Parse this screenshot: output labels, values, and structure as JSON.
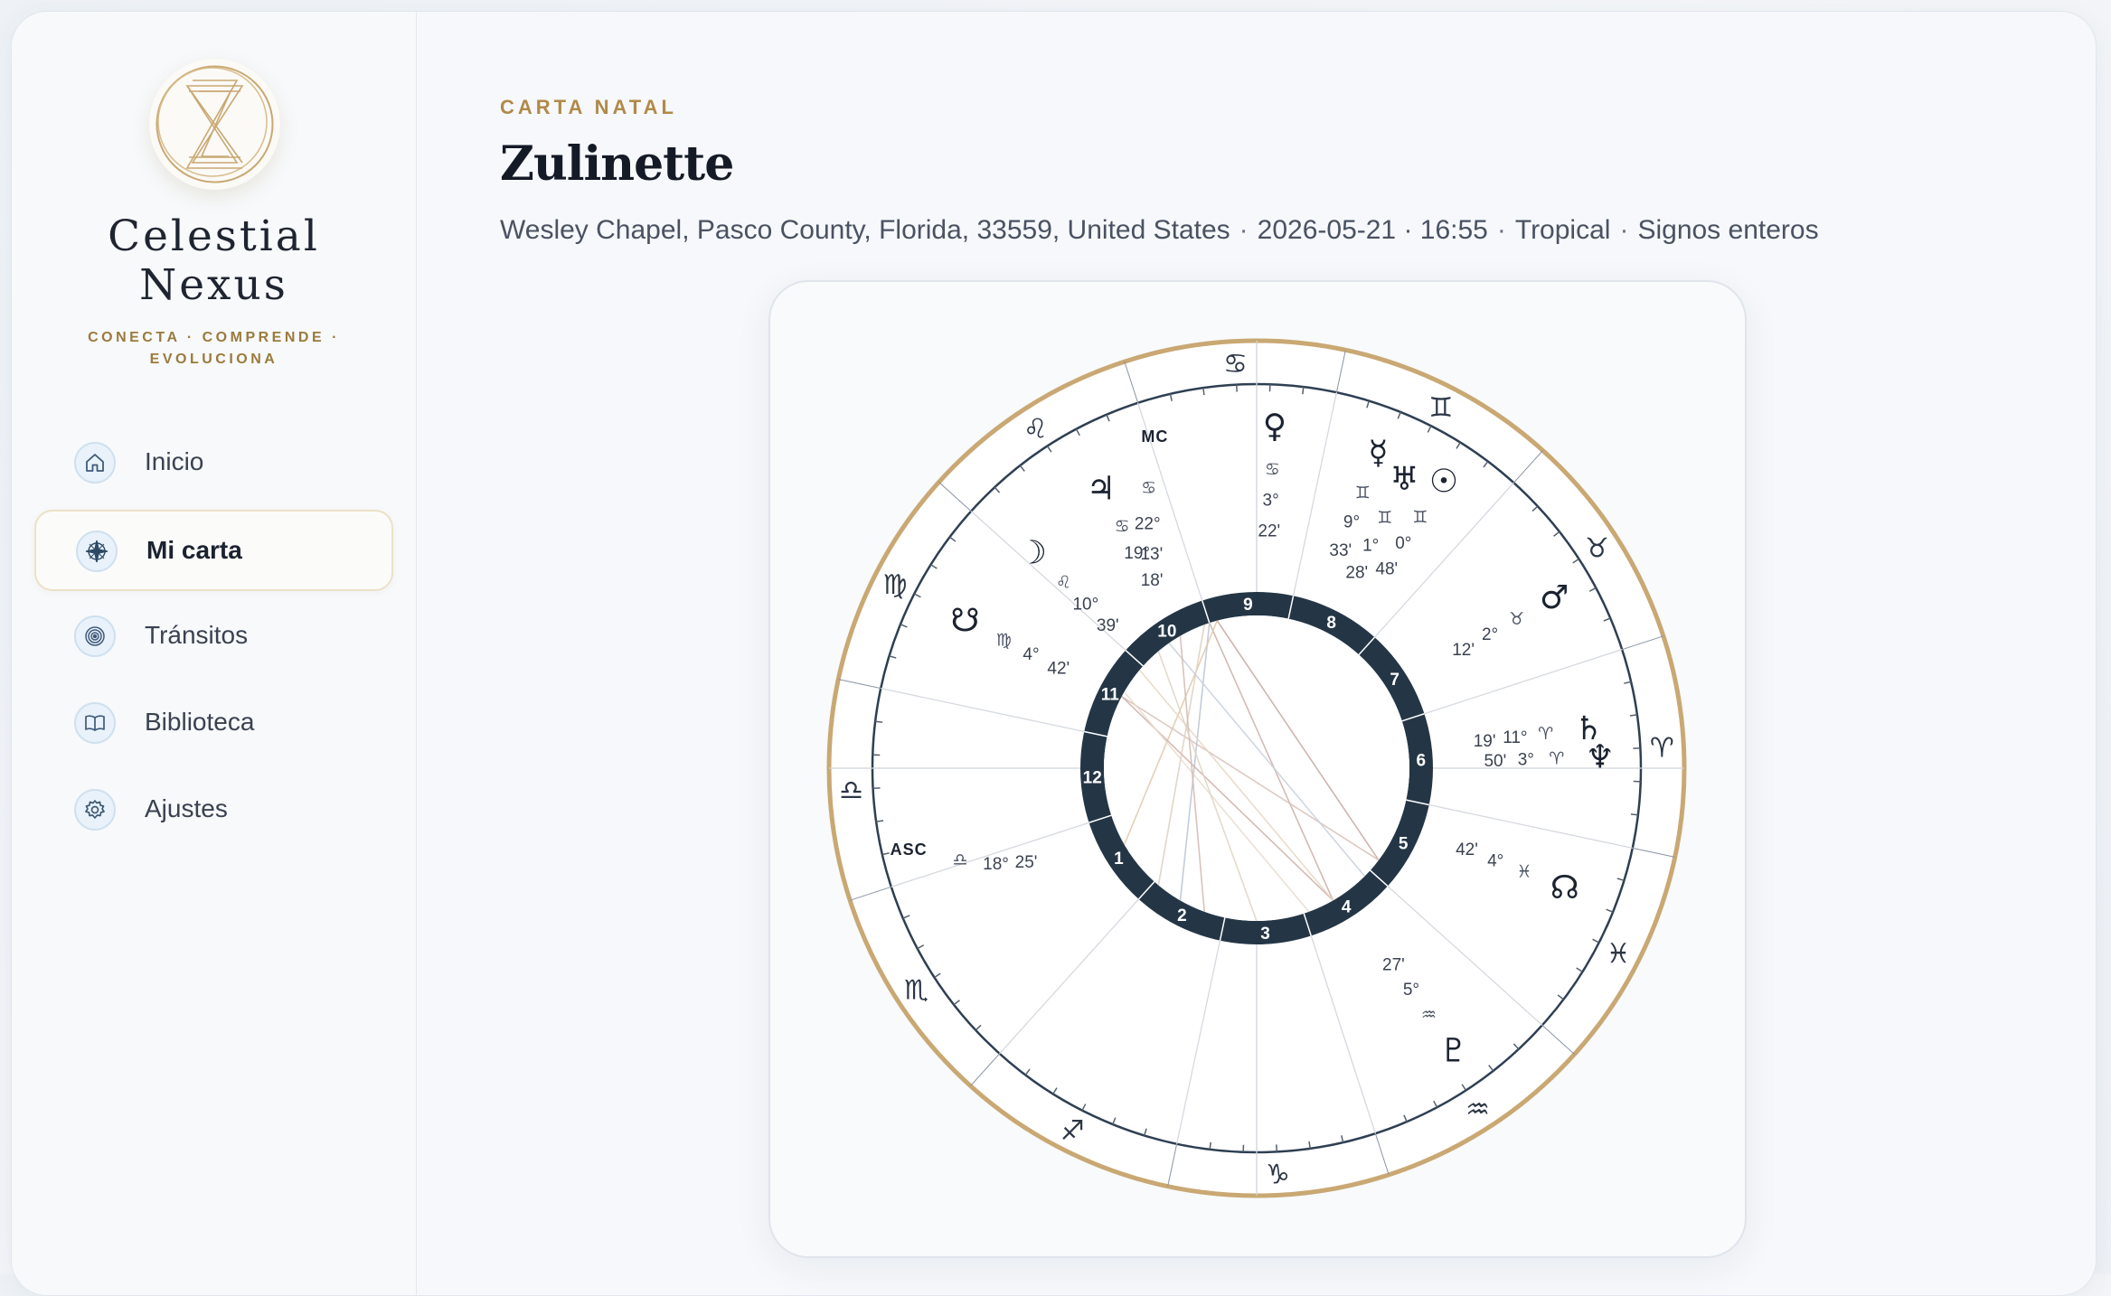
{
  "brand": {
    "name_line1": "Celestial",
    "name_line2": "Nexus",
    "tagline": "CONECTA · COMPRENDE · EVOLUCIONA"
  },
  "nav": [
    {
      "label": "Inicio",
      "icon": "home-icon",
      "active": false
    },
    {
      "label": "Mi carta",
      "icon": "compass-rose-icon",
      "active": true
    },
    {
      "label": "Tránsitos",
      "icon": "concentric-circles-icon",
      "active": false
    },
    {
      "label": "Biblioteca",
      "icon": "book-icon",
      "active": false
    },
    {
      "label": "Ajustes",
      "icon": "gear-icon",
      "active": false
    }
  ],
  "header": {
    "eyebrow": "CARTA NATAL",
    "title": "Zulinette",
    "location": "Wesley Chapel, Pasco County, Florida, 33559, United States",
    "datetime": "2026-05-21 · 16:55",
    "zodiac": "Tropical",
    "houses": "Signos enteros"
  },
  "colors": {
    "accent_gold": "#c9a873",
    "house_ring": "#243646",
    "ink": "#1b2230"
  },
  "chart": {
    "signs": [
      {
        "glyph": "♎",
        "name": "Libra"
      },
      {
        "glyph": "♏",
        "name": "Scorpio"
      },
      {
        "glyph": "♐",
        "name": "Sagittarius"
      },
      {
        "glyph": "♑",
        "name": "Capricorn"
      },
      {
        "glyph": "♒",
        "name": "Aquarius"
      },
      {
        "glyph": "♓",
        "name": "Pisces"
      },
      {
        "glyph": "♈",
        "name": "Aries"
      },
      {
        "glyph": "♉",
        "name": "Taurus"
      },
      {
        "glyph": "♊",
        "name": "Gemini"
      },
      {
        "glyph": "♋",
        "name": "Cancer"
      },
      {
        "glyph": "♌",
        "name": "Leo"
      },
      {
        "glyph": "♍",
        "name": "Virgo"
      }
    ],
    "houses": [
      "1",
      "2",
      "3",
      "4",
      "5",
      "6",
      "7",
      "8",
      "9",
      "10",
      "11",
      "12"
    ],
    "angles": [
      {
        "name": "asc",
        "label": "ASC",
        "sign": "♎",
        "deg": "18°",
        "min": "25'"
      },
      {
        "name": "mc",
        "label": "MC",
        "sign": "♋",
        "deg": "22°",
        "min": "13'"
      }
    ],
    "points": [
      {
        "name": "sun",
        "glyph": "☉",
        "sign": "♊",
        "deg": "0°",
        "min": "48'"
      },
      {
        "name": "moon",
        "glyph": "☽",
        "sign": "♌",
        "deg": "10°",
        "min": "39'"
      },
      {
        "name": "mercury",
        "glyph": "☿",
        "sign": "♊",
        "deg": "9°",
        "min": "33'"
      },
      {
        "name": "venus",
        "glyph": "♀",
        "sign": "♋",
        "deg": "3°",
        "min": "22'"
      },
      {
        "name": "mars",
        "glyph": "♂",
        "sign": "♉",
        "deg": "2°",
        "min": "12'"
      },
      {
        "name": "jupiter",
        "glyph": "♃",
        "sign": "♋",
        "deg": "19°",
        "min": "18'"
      },
      {
        "name": "saturn",
        "glyph": "♄",
        "sign": "♈",
        "deg": "11°",
        "min": "19'"
      },
      {
        "name": "uranus",
        "glyph": "♅",
        "sign": "♊",
        "deg": "1°",
        "min": "28'"
      },
      {
        "name": "neptune",
        "glyph": "♆",
        "sign": "♈",
        "deg": "3°",
        "min": "50'"
      },
      {
        "name": "pluto",
        "glyph": "♇",
        "sign": "♒",
        "deg": "5°",
        "min": "27'"
      },
      {
        "name": "north-node",
        "glyph": "☊",
        "sign": "♓",
        "deg": "4°",
        "min": "42'"
      },
      {
        "name": "south-node",
        "glyph": "☋",
        "sign": "♍",
        "deg": "4°",
        "min": "42'"
      }
    ]
  }
}
